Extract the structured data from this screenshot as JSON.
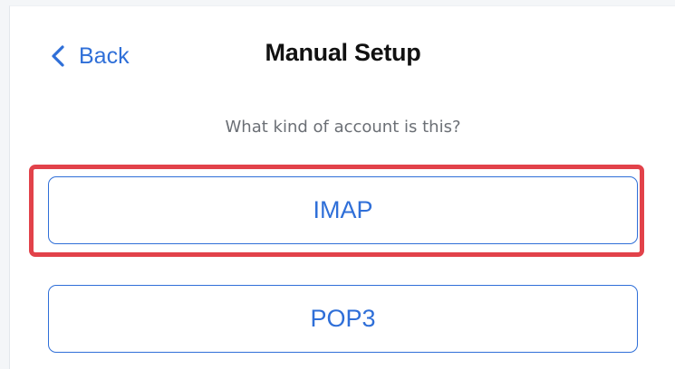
{
  "header": {
    "back_label": "Back",
    "title": "Manual Setup"
  },
  "prompt": "What kind of account is this?",
  "options": [
    {
      "label": "IMAP",
      "highlighted": true
    },
    {
      "label": "POP3",
      "highlighted": false
    }
  ],
  "colors": {
    "accent": "#2f6fd8",
    "highlight": "#e2424a",
    "title": "#111111",
    "prompt": "#6b6f75"
  },
  "icons": {
    "back": "chevron-left-icon"
  }
}
